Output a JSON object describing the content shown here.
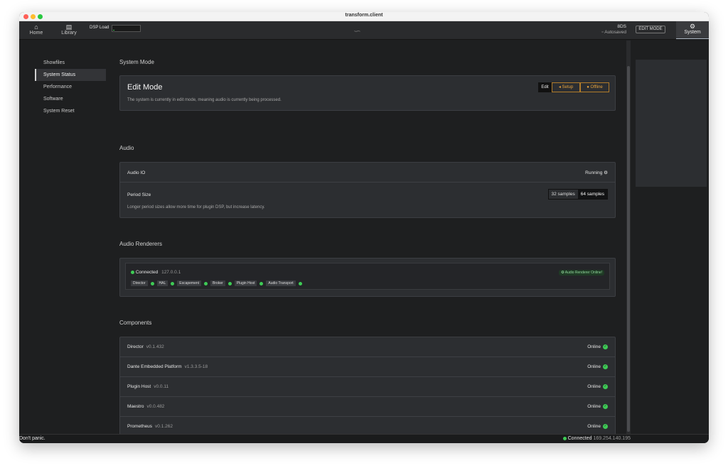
{
  "window": {
    "title": "transform.client"
  },
  "topbar": {
    "nav": [
      {
        "icon": "home-icon",
        "label": "Home"
      },
      {
        "icon": "library-icon",
        "label": "Library"
      }
    ],
    "dsp_load_label": "DSP Load",
    "dsp_load_value": 0,
    "project_name": "8DS",
    "autosave_status": "Autosaved",
    "edit_mode_button": "EDIT MODE",
    "system_tab": "System"
  },
  "sidebar": {
    "items": [
      {
        "label": "Showfiles",
        "active": false
      },
      {
        "label": "System Status",
        "active": true
      },
      {
        "label": "Performance",
        "active": false
      },
      {
        "label": "Software",
        "active": false
      },
      {
        "label": "System Reset",
        "active": false
      }
    ]
  },
  "system_mode": {
    "section_title": "System Mode",
    "mode_title": "Edit Mode",
    "description": "The system is currently in edit mode, meaning audio is currently being processed.",
    "buttons": {
      "edit": "Edit",
      "setup": "Setup",
      "offline": "Offline"
    }
  },
  "audio": {
    "section_title": "Audio",
    "io_label": "Audio IO",
    "io_status": "Running",
    "period_label": "Period Size",
    "period_desc": "Longer period sizes allow more time for plugin DSP, but increase latency.",
    "period_options": [
      "32 samples",
      "64 samples"
    ],
    "period_selected": "64 samples"
  },
  "renderers": {
    "section_title": "Audio Renderers",
    "status": "Connected",
    "ip": "127.0.0.1",
    "badge": "Audio Renderer",
    "badge_status": "Online!",
    "chips": [
      "Director",
      "HAL",
      "Escapement",
      "Broker",
      "Plugin Host",
      "Audio Transport"
    ]
  },
  "components": {
    "section_title": "Components",
    "rows": [
      {
        "name": "Director",
        "version": "v0.1.432",
        "status": "Online"
      },
      {
        "name": "Dante Embedded Platform",
        "version": "v1.3.3.5-18",
        "status": "Online"
      },
      {
        "name": "Plugin Host",
        "version": "v0.0.11",
        "status": "Online"
      },
      {
        "name": "Maestro",
        "version": "v0.0.482",
        "status": "Online"
      },
      {
        "name": "Prometheus",
        "version": "v0.1.262",
        "status": "Online"
      }
    ]
  },
  "statusbar": {
    "left": "Don't panic.",
    "connection": "Connected",
    "ip": "169.254.140.195"
  },
  "colors": {
    "accent_green": "#3ecb55",
    "accent_orange": "#e5a23c",
    "background": "#1e1f20"
  }
}
